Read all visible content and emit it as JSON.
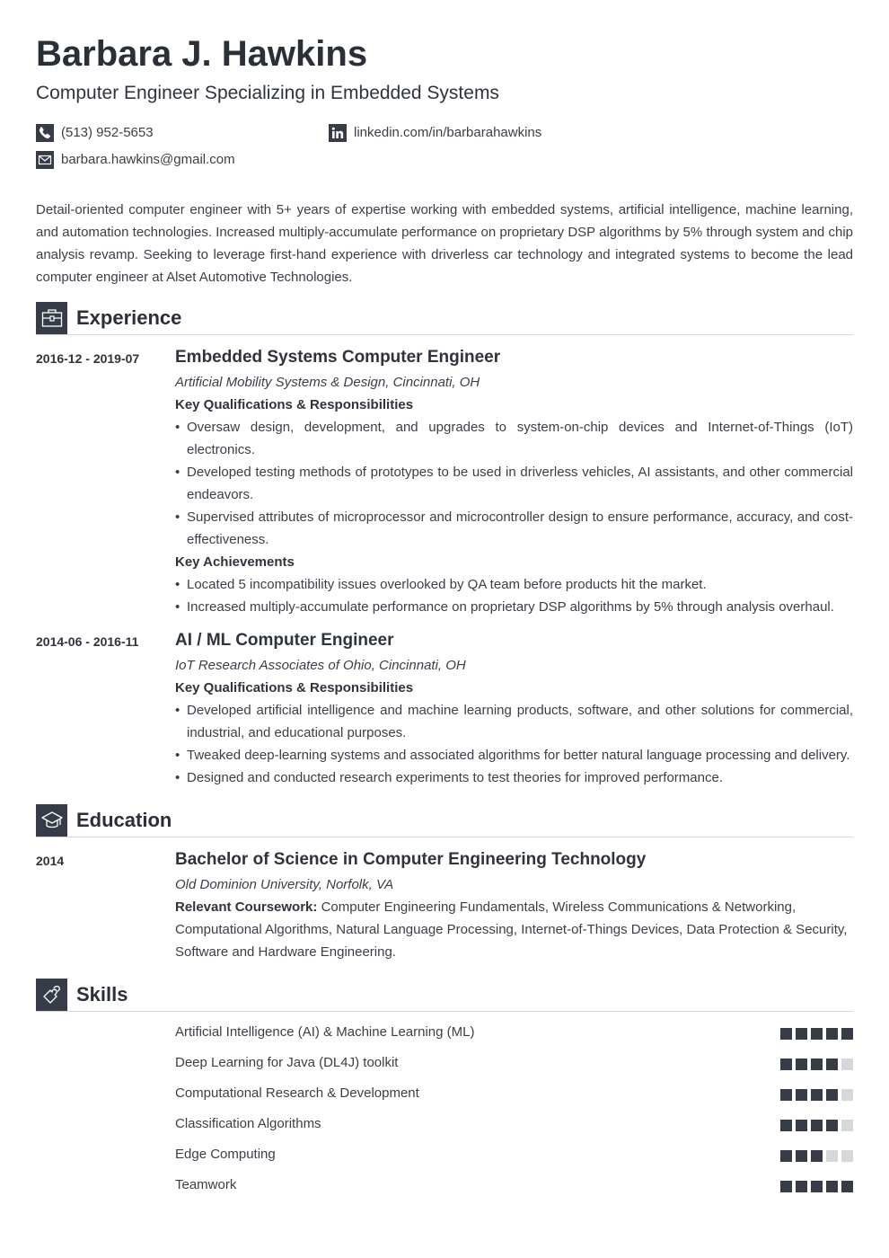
{
  "header": {
    "name": "Barbara J. Hawkins",
    "headline": "Computer Engineer Specializing in Embedded Systems",
    "contacts": {
      "phone": {
        "icon": "phone-icon",
        "value": "(513) 952-5653"
      },
      "linkedin": {
        "icon": "linkedin-icon",
        "value": "linkedin.com/in/barbarahawkins"
      },
      "email": {
        "icon": "email-icon",
        "value": "barbara.hawkins@gmail.com"
      }
    }
  },
  "summary": "Detail-oriented computer engineer with 5+ years of expertise working with embedded systems, artificial intelligence, machine learning, and automation technologies. Increased multiply-accumulate performance on proprietary DSP algorithms by 5% through system and chip analysis revamp. Seeking to leverage first-hand experience with driverless car technology and integrated systems to become the lead computer engineer at Alset Automotive Technologies.",
  "experience": {
    "title": "Experience",
    "icon": "briefcase-icon",
    "jobs": [
      {
        "dates": "2016-12 - 2019-07",
        "title": "Embedded Systems Computer Engineer",
        "company": "Artificial Mobility Systems & Design, Cincinnati, OH",
        "qual_heading": "Key Qualifications & Responsibilities",
        "qualifications": [
          "Oversaw design, development, and upgrades to system-on-chip devices and Internet-of-Things (IoT) electronics.",
          "Developed testing methods of prototypes to be used in driverless vehicles, AI assistants, and other commercial endeavors.",
          "Supervised attributes of microprocessor and microcontroller design to ensure performance, accuracy, and cost-effectiveness."
        ],
        "ach_heading": "Key Achievements",
        "achievements": [
          "Located 5 incompatibility issues overlooked by QA team before products hit the market.",
          "Increased multiply-accumulate performance on proprietary DSP algorithms by 5% through analysis overhaul."
        ]
      },
      {
        "dates": "2014-06 - 2016-11",
        "title": "AI / ML Computer Engineer",
        "company": "IoT Research Associates of Ohio, Cincinnati, OH",
        "qual_heading": "Key Qualifications & Responsibilities",
        "qualifications": [
          "Developed artificial intelligence and machine learning products, software, and other solutions for commercial, industrial, and educational purposes.",
          "Tweaked deep-learning systems and associated algorithms for better natural language processing and delivery.",
          "Designed and conducted research experiments to test theories for improved performance."
        ]
      }
    ]
  },
  "education": {
    "title": "Education",
    "icon": "graduation-cap-icon",
    "entries": [
      {
        "year": "2014",
        "degree": "Bachelor of Science in Computer Engineering Technology",
        "school": "Old Dominion University, Norfolk, VA",
        "coursework_label": "Relevant Coursework:",
        "coursework": "Computer Engineering Fundamentals, Wireless Communications & Networking, Computational Algorithms, Natural Language Processing, Internet-of-Things Devices, Data Protection & Security, Software and Hardware Engineering."
      }
    ]
  },
  "skills": {
    "title": "Skills",
    "icon": "puzzle-piece-icon",
    "max_level": 5,
    "items": [
      {
        "name": "Artificial Intelligence (AI) & Machine Learning (ML)",
        "level": 5
      },
      {
        "name": "Deep Learning for Java (DL4J) toolkit",
        "level": 4
      },
      {
        "name": "Computational Research & Development",
        "level": 4
      },
      {
        "name": "Classification Algorithms",
        "level": 4
      },
      {
        "name": "Edge Computing",
        "level": 3
      },
      {
        "name": "Teamwork",
        "level": 5
      }
    ]
  },
  "colors": {
    "accent": "#363c47",
    "text": "#3a3f47",
    "rating_empty": "#d5d7d8",
    "rule": "#d6d8db"
  }
}
